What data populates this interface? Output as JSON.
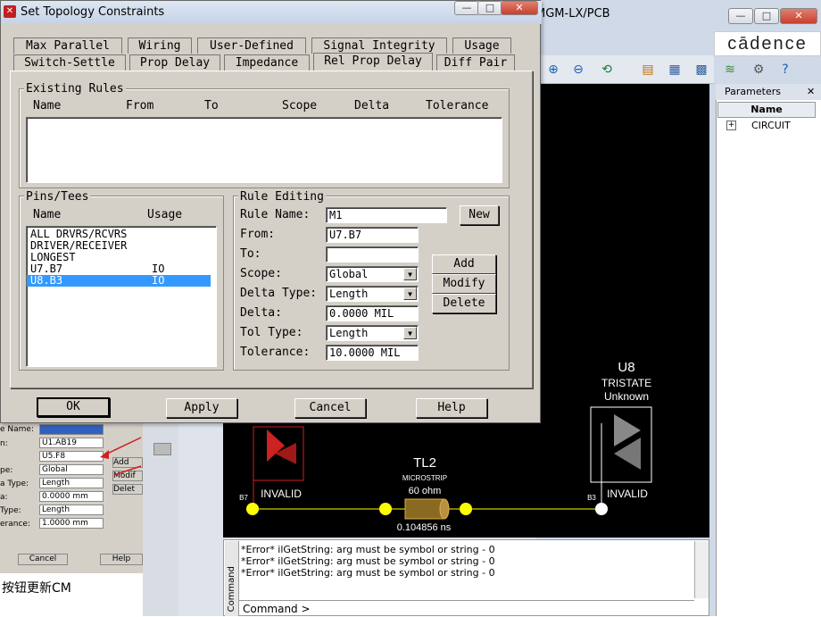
{
  "dialog": {
    "title": "Set Topology Constraints",
    "tabs_row1": [
      "Max Parallel",
      "Wiring",
      "User-Defined",
      "Signal Integrity",
      "Usage"
    ],
    "tabs_row2": [
      "Switch-Settle",
      "Prop Delay",
      "Impedance",
      "Rel Prop Delay",
      "Diff Pair"
    ],
    "active_tab": "Rel Prop Delay",
    "existing_rules": {
      "label": "Existing Rules",
      "columns": [
        "Name",
        "From",
        "To",
        "Scope",
        "Delta",
        "Tolerance"
      ]
    },
    "pins_tees": {
      "label": "Pins/Tees",
      "columns": [
        "Name",
        "Usage"
      ],
      "items": [
        {
          "name": "ALL DRVRS/RCVRS",
          "usage": ""
        },
        {
          "name": "DRIVER/RECEIVER",
          "usage": ""
        },
        {
          "name": "LONGEST",
          "usage": ""
        },
        {
          "name": "U7.B7",
          "usage": "IO"
        },
        {
          "name": "U8.B3",
          "usage": "IO"
        }
      ],
      "selected_index": 4
    },
    "rule_editing": {
      "label": "Rule Editing",
      "rule_name_label": "Rule Name:",
      "rule_name": "M1",
      "new_label": "New",
      "from_label": "From:",
      "from": "U7.B7",
      "to_label": "To:",
      "to": "",
      "scope_label": "Scope:",
      "scope": "Global",
      "delta_type_label": "Delta Type:",
      "delta_type": "Length",
      "delta_label": "Delta:",
      "delta": "0.0000 MIL",
      "tol_type_label": "Tol Type:",
      "tol_type": "Length",
      "tolerance_label": "Tolerance:",
      "tolerance": "10.0000 MIL",
      "add_label": "Add",
      "modify_label": "Modify",
      "delete_label": "Delete"
    },
    "buttons": {
      "ok": "OK",
      "apply": "Apply",
      "cancel": "Cancel",
      "help": "Help"
    }
  },
  "main_window": {
    "title_fragment": "MGM-LX/PCB",
    "logo": "cādence",
    "parameters": {
      "title": "Parameters",
      "column": "Name",
      "row": "CIRCUIT"
    }
  },
  "schematic": {
    "u8": {
      "ref": "U8",
      "type": "TRISTATE",
      "status": "Unknown",
      "state": "INVALID",
      "pin": "B3"
    },
    "u7": {
      "state": "INVALID",
      "pin": "B7"
    },
    "tl": {
      "ref": "TL2",
      "kind": "MICROSTRIP",
      "impedance": "60 ohm",
      "delay": "0.104856 ns"
    }
  },
  "command": {
    "side_label": "Command",
    "lines": [
      "*Error* ilGetString: arg must be symbol or string - 0",
      "*Error* ilGetString: arg must be symbol or string - 0",
      "*Error* ilGetString: arg must be symbol or string - 0"
    ],
    "prompt": "Command >"
  },
  "background_dialog": {
    "labels": [
      "e Name:",
      "n:",
      "",
      "pe:",
      "a Type:",
      "a:",
      "Type:",
      "erance:"
    ],
    "values": [
      "",
      "U1.AB19",
      "U5.F8",
      "Global",
      "Length",
      "0.0000 mm",
      "Length",
      "1.0000 mm"
    ],
    "cancel": "Cancel",
    "help": "Help",
    "add": "Add",
    "modify": "Modif",
    "delete": "Delet",
    "caption": "按钮更新CM"
  },
  "colors": {
    "canvas": "#000000",
    "selection": "#3399ff",
    "wire": "#ffff00",
    "invalid_red": "#cc2222"
  }
}
